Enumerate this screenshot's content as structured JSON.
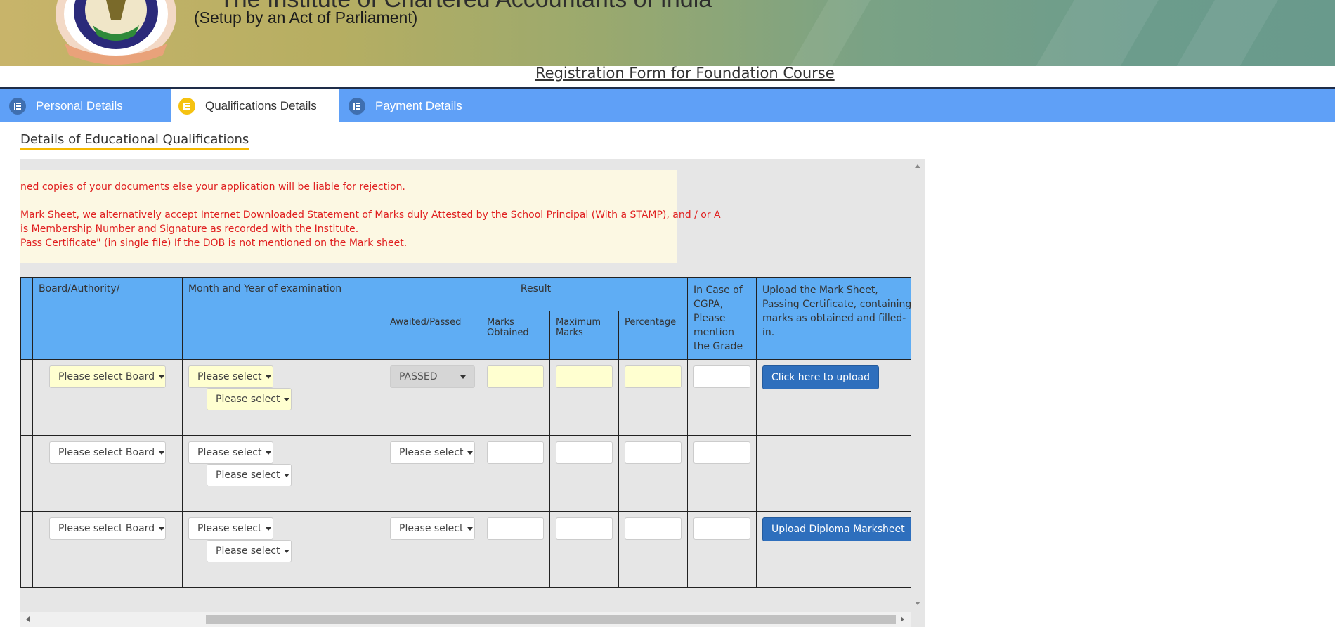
{
  "header": {
    "org_name": "The Institute of Chartered Accountants of India",
    "org_subtitle": "(Setup by an Act of Parliament)",
    "form_title": "Registration Form for Foundation Course"
  },
  "tabs": [
    {
      "label": "Personal Details",
      "icon": "form-icon",
      "active": false
    },
    {
      "label": "Qualifications Details",
      "icon": "form-icon",
      "active": true
    },
    {
      "label": "Payment Details",
      "icon": "form-icon",
      "active": false
    }
  ],
  "section": {
    "title": "Details of Educational Qualifications"
  },
  "notice": {
    "lines": [
      "ned copies of your documents else your application will be liable for rejection.",
      "Mark Sheet, we alternatively accept Internet Downloaded Statement of Marks duly Attested by the School Principal (With a STAMP), and / or A",
      "is Membership Number and Signature as recorded with the Institute.",
      "Pass Certificate\" (in single file) If the DOB is not mentioned on the Mark sheet."
    ]
  },
  "table": {
    "headers": {
      "board": "Board/Authority/",
      "month_year": "Month and Year of examination",
      "result": "Result",
      "awaited": "Awaited/Passed",
      "marks_obtained": "Marks Obtained",
      "maximum_marks": "Maximum Marks",
      "percentage": "Percentage",
      "cgpa": "In Case of CGPA, Please mention the Grade",
      "upload": "Upload the Mark Sheet, Passing Certificate, containing marks as obtained and filled-in."
    },
    "rows": [
      {
        "board": "Please select Board",
        "month": "Please select",
        "year": "Please select",
        "status": "PASSED",
        "upload_label": "Click here to upload"
      },
      {
        "board": "Please select Board",
        "month": "Please select",
        "year": "Please select",
        "status": "Please select",
        "upload_label": ""
      },
      {
        "board": "Please select Board",
        "month": "Please select",
        "year": "Please select",
        "status": "Please select",
        "upload_label": "Upload Diploma Marksheet"
      }
    ]
  },
  "colors": {
    "tab_bar": "#5fa0f7",
    "table_header": "#5fadf4",
    "upload_button": "#2e6fbd",
    "notice_text": "#e02020",
    "required_field": "#ffffd0",
    "active_tab_icon": "#f5c211"
  }
}
